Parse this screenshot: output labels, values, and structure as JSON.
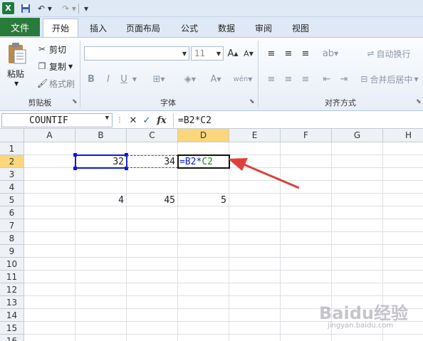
{
  "quick_access": {
    "logo": "X"
  },
  "tabs": [
    "文件",
    "开始",
    "插入",
    "页面布局",
    "公式",
    "数据",
    "审阅",
    "视图"
  ],
  "ribbon": {
    "clipboard": {
      "paste": "粘贴",
      "cut": "剪切",
      "copy": "复制",
      "format_painter": "格式刷",
      "group_label": "剪贴板"
    },
    "font": {
      "font_name": "",
      "font_size": "11",
      "bold": "B",
      "italic": "I",
      "underline": "U",
      "group_label": "字体"
    },
    "alignment": {
      "wrap_text": "自动换行",
      "merge_center": "合并后居中",
      "group_label": "对齐方式"
    }
  },
  "formula_bar": {
    "name_box": "COUNTIF",
    "cancel": "✕",
    "enter": "✓",
    "fx": "fx",
    "formula": "=B2*C2"
  },
  "grid": {
    "columns": [
      "A",
      "B",
      "C",
      "D",
      "E",
      "F",
      "G",
      "H"
    ],
    "rows": [
      "1",
      "2",
      "3",
      "4",
      "5",
      "6",
      "7",
      "8",
      "9",
      "10",
      "11",
      "12",
      "13",
      "14",
      "15",
      "16"
    ],
    "cells": {
      "B2": "32",
      "C2": "34",
      "D2_ref1": "=B2*",
      "D2_ref2": "C2",
      "B5": "4",
      "C5": "45",
      "D5": "5"
    }
  },
  "watermark": {
    "brand": "Baidu经验",
    "url": "jingyan.baidu.com"
  },
  "colors": {
    "file_tab": "#2a7a3a",
    "ref_b2": "#0a1ad6",
    "ref_c2": "#1a8a1a",
    "arrow": "#e0403a",
    "active_header": "#f9d77a"
  }
}
